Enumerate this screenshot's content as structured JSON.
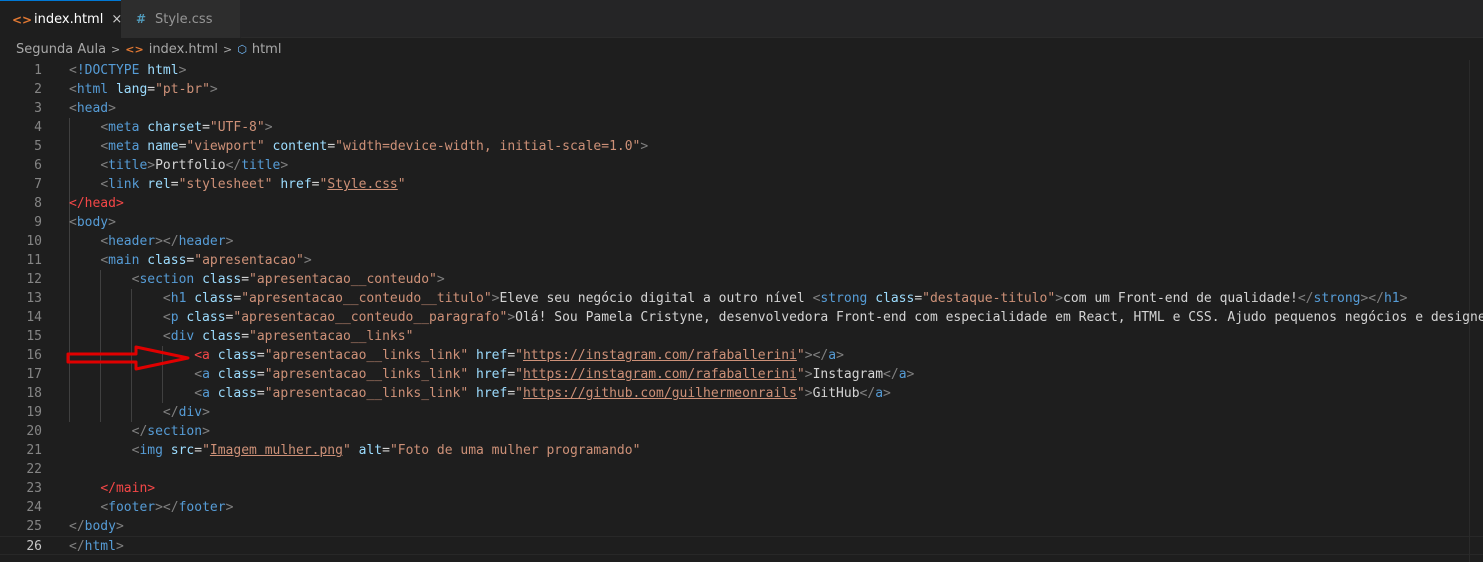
{
  "tabs": [
    {
      "label": "index.html",
      "icon": "html-file-icon",
      "active": true
    },
    {
      "label": "Style.css",
      "icon": "css-file-icon",
      "active": false
    }
  ],
  "breadcrumb": [
    "Segunda Aula",
    "index.html",
    "html"
  ],
  "icon_glyphs": {
    "html": "<>",
    "css": "#",
    "close": "×",
    "chevron": ">",
    "cube": "⬡"
  },
  "current_line": 26,
  "colors": {
    "accent": "#0078d4",
    "arrow": "#e00000"
  },
  "lines": [
    [
      "1",
      [
        [
          "t-punc",
          "<"
        ],
        [
          "t-tag",
          "!DOCTYPE "
        ],
        [
          "t-attr",
          "html"
        ],
        [
          "t-punc",
          ">"
        ]
      ]
    ],
    [
      "2",
      [
        [
          "t-punc",
          "<"
        ],
        [
          "t-tag",
          "html "
        ],
        [
          "t-attr",
          "lang"
        ],
        [
          "t-txt",
          "="
        ],
        [
          "t-str",
          "\"pt-br\""
        ],
        [
          "t-punc",
          ">"
        ]
      ]
    ],
    [
      "3",
      [
        [
          "t-punc",
          "<"
        ],
        [
          "t-tag",
          "head"
        ],
        [
          "t-punc",
          ">"
        ]
      ]
    ],
    [
      "4",
      [
        [
          "t-txt",
          "    "
        ],
        [
          "t-punc",
          "<"
        ],
        [
          "t-tag",
          "meta "
        ],
        [
          "t-attr",
          "charset"
        ],
        [
          "t-txt",
          "="
        ],
        [
          "t-str",
          "\"UTF-8\""
        ],
        [
          "t-punc",
          ">"
        ]
      ]
    ],
    [
      "5",
      [
        [
          "t-txt",
          "    "
        ],
        [
          "t-punc",
          "<"
        ],
        [
          "t-tag",
          "meta "
        ],
        [
          "t-attr",
          "name"
        ],
        [
          "t-txt",
          "="
        ],
        [
          "t-str",
          "\"viewport\" "
        ],
        [
          "t-attr",
          "content"
        ],
        [
          "t-txt",
          "="
        ],
        [
          "t-str",
          "\"width=device-width, initial-scale=1.0\""
        ],
        [
          "t-punc",
          ">"
        ]
      ]
    ],
    [
      "6",
      [
        [
          "t-txt",
          "    "
        ],
        [
          "t-punc",
          "<"
        ],
        [
          "t-tag",
          "title"
        ],
        [
          "t-punc",
          ">"
        ],
        [
          "t-txt",
          "Portfolio"
        ],
        [
          "t-punc",
          "</"
        ],
        [
          "t-tag",
          "title"
        ],
        [
          "t-punc",
          ">"
        ]
      ]
    ],
    [
      "7",
      [
        [
          "t-txt",
          "    "
        ],
        [
          "t-punc",
          "<"
        ],
        [
          "t-tag",
          "link "
        ],
        [
          "t-attr",
          "rel"
        ],
        [
          "t-txt",
          "="
        ],
        [
          "t-str",
          "\"stylesheet\" "
        ],
        [
          "t-attr",
          "href"
        ],
        [
          "t-txt",
          "="
        ],
        [
          "t-str",
          "\""
        ],
        [
          "t-str u",
          "Style.css"
        ],
        [
          "t-str",
          "\""
        ]
      ]
    ],
    [
      "8",
      [
        [
          "t-red",
          "</head>"
        ]
      ]
    ],
    [
      "9",
      [
        [
          "t-punc",
          "<"
        ],
        [
          "t-tag",
          "body"
        ],
        [
          "t-punc",
          ">"
        ]
      ]
    ],
    [
      "10",
      [
        [
          "t-txt",
          "    "
        ],
        [
          "t-punc",
          "<"
        ],
        [
          "t-tag",
          "header"
        ],
        [
          "t-punc",
          "></"
        ],
        [
          "t-tag",
          "header"
        ],
        [
          "t-punc",
          ">"
        ]
      ]
    ],
    [
      "11",
      [
        [
          "t-txt",
          "    "
        ],
        [
          "t-punc",
          "<"
        ],
        [
          "t-tag",
          "main "
        ],
        [
          "t-attr",
          "class"
        ],
        [
          "t-txt",
          "="
        ],
        [
          "t-str",
          "\"apresentacao\""
        ],
        [
          "t-punc",
          ">"
        ]
      ]
    ],
    [
      "12",
      [
        [
          "t-txt",
          "        "
        ],
        [
          "t-punc",
          "<"
        ],
        [
          "t-tag",
          "section "
        ],
        [
          "t-attr",
          "class"
        ],
        [
          "t-txt",
          "="
        ],
        [
          "t-str",
          "\"apresentacao__conteudo\""
        ],
        [
          "t-punc",
          ">"
        ]
      ]
    ],
    [
      "13",
      [
        [
          "t-txt",
          "            "
        ],
        [
          "t-punc",
          "<"
        ],
        [
          "t-tag",
          "h1 "
        ],
        [
          "t-attr",
          "class"
        ],
        [
          "t-txt",
          "="
        ],
        [
          "t-str",
          "\"apresentacao__conteudo__titulo\""
        ],
        [
          "t-punc",
          ">"
        ],
        [
          "t-txt",
          "Eleve seu negócio digital a outro nível "
        ],
        [
          "t-punc",
          "<"
        ],
        [
          "t-tag",
          "strong "
        ],
        [
          "t-attr",
          "class"
        ],
        [
          "t-txt",
          "="
        ],
        [
          "t-str",
          "\"destaque-titulo\""
        ],
        [
          "t-punc",
          ">"
        ],
        [
          "t-txt",
          "com um Front-end de qualidade!"
        ],
        [
          "t-punc",
          "</"
        ],
        [
          "t-tag",
          "strong"
        ],
        [
          "t-punc",
          "></"
        ],
        [
          "t-tag",
          "h1"
        ],
        [
          "t-punc",
          ">"
        ]
      ]
    ],
    [
      "14",
      [
        [
          "t-txt",
          "            "
        ],
        [
          "t-punc",
          "<"
        ],
        [
          "t-tag",
          "p "
        ],
        [
          "t-attr",
          "class"
        ],
        [
          "t-txt",
          "="
        ],
        [
          "t-str",
          "\"apresentacao__conteudo__paragrafo\""
        ],
        [
          "t-punc",
          ">"
        ],
        [
          "t-txt",
          "Olá! Sou Pamela Cristyne, desenvolvedora Front-end com especialidade em React, HTML e CSS. Ajudo pequenos negócios e designers"
        ]
      ]
    ],
    [
      "15",
      [
        [
          "t-txt",
          "            "
        ],
        [
          "t-punc",
          "<"
        ],
        [
          "t-tag",
          "div "
        ],
        [
          "t-attr",
          "class"
        ],
        [
          "t-txt",
          "="
        ],
        [
          "t-str",
          "\"apresentacao__links\""
        ]
      ]
    ],
    [
      "16",
      [
        [
          "t-txt",
          "                "
        ],
        [
          "t-red",
          "<a "
        ],
        [
          "t-attr",
          "class"
        ],
        [
          "t-txt",
          "="
        ],
        [
          "t-str",
          "\"apresentacao__links_link\" "
        ],
        [
          "t-attr",
          "href"
        ],
        [
          "t-txt",
          "="
        ],
        [
          "t-str",
          "\""
        ],
        [
          "t-str u",
          "https://instagram.com/rafaballerini"
        ],
        [
          "t-str",
          "\""
        ],
        [
          "t-punc",
          "></"
        ],
        [
          "t-tag",
          "a"
        ],
        [
          "t-punc",
          ">"
        ]
      ]
    ],
    [
      "17",
      [
        [
          "t-txt",
          "                "
        ],
        [
          "t-punc",
          "<"
        ],
        [
          "t-tag",
          "a "
        ],
        [
          "t-attr",
          "class"
        ],
        [
          "t-txt",
          "="
        ],
        [
          "t-str",
          "\"apresentacao__links_link\" "
        ],
        [
          "t-attr",
          "href"
        ],
        [
          "t-txt",
          "="
        ],
        [
          "t-str",
          "\""
        ],
        [
          "t-str u",
          "https://instagram.com/rafaballerini"
        ],
        [
          "t-str",
          "\""
        ],
        [
          "t-punc",
          ">"
        ],
        [
          "t-txt",
          "Instagram"
        ],
        [
          "t-punc",
          "</"
        ],
        [
          "t-tag",
          "a"
        ],
        [
          "t-punc",
          ">"
        ]
      ]
    ],
    [
      "18",
      [
        [
          "t-txt",
          "                "
        ],
        [
          "t-punc",
          "<"
        ],
        [
          "t-tag",
          "a "
        ],
        [
          "t-attr",
          "class"
        ],
        [
          "t-txt",
          "="
        ],
        [
          "t-str",
          "\"apresentacao__links_link\" "
        ],
        [
          "t-attr",
          "href"
        ],
        [
          "t-txt",
          "="
        ],
        [
          "t-str",
          "\""
        ],
        [
          "t-str u",
          "https://github.com/guilhermeonrails"
        ],
        [
          "t-str",
          "\""
        ],
        [
          "t-punc",
          ">"
        ],
        [
          "t-txt",
          "GitHub"
        ],
        [
          "t-punc",
          "</"
        ],
        [
          "t-tag",
          "a"
        ],
        [
          "t-punc",
          ">"
        ]
      ]
    ],
    [
      "19",
      [
        [
          "t-txt",
          "            "
        ],
        [
          "t-punc",
          "</"
        ],
        [
          "t-tag",
          "div"
        ],
        [
          "t-punc",
          ">"
        ]
      ]
    ],
    [
      "20",
      [
        [
          "t-txt",
          "        "
        ],
        [
          "t-punc",
          "</"
        ],
        [
          "t-tag",
          "section"
        ],
        [
          "t-punc",
          ">"
        ]
      ]
    ],
    [
      "21",
      [
        [
          "t-txt",
          "        "
        ],
        [
          "t-punc",
          "<"
        ],
        [
          "t-tag",
          "img "
        ],
        [
          "t-attr",
          "src"
        ],
        [
          "t-txt",
          "="
        ],
        [
          "t-str",
          "\""
        ],
        [
          "t-str u",
          "Imagem mulher.png"
        ],
        [
          "t-str",
          "\" "
        ],
        [
          "t-attr",
          "alt"
        ],
        [
          "t-txt",
          "="
        ],
        [
          "t-str",
          "\"Foto de uma mulher programando\""
        ]
      ]
    ],
    [
      "22",
      []
    ],
    [
      "23",
      [
        [
          "t-txt",
          "    "
        ],
        [
          "t-red",
          "</main>"
        ]
      ]
    ],
    [
      "24",
      [
        [
          "t-txt",
          "    "
        ],
        [
          "t-punc",
          "<"
        ],
        [
          "t-tag",
          "footer"
        ],
        [
          "t-punc",
          "></"
        ],
        [
          "t-tag",
          "footer"
        ],
        [
          "t-punc",
          ">"
        ]
      ]
    ],
    [
      "25",
      [
        [
          "t-punc",
          "</"
        ],
        [
          "t-tag",
          "body"
        ],
        [
          "t-punc",
          ">"
        ]
      ]
    ],
    [
      "26",
      [
        [
          "t-punc",
          "</"
        ],
        [
          "t-tag",
          "html"
        ],
        [
          "t-punc",
          ">"
        ]
      ]
    ]
  ]
}
